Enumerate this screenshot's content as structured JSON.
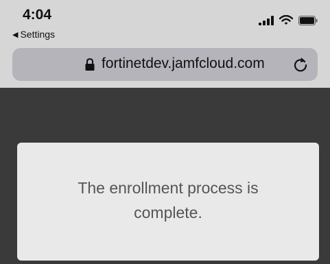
{
  "status_bar": {
    "time": "4:04",
    "back_label": "Settings",
    "icons": [
      "cellular-signal-icon",
      "wifi-icon",
      "battery-icon"
    ]
  },
  "browser": {
    "url": "fortinetdev.jamfcloud.com",
    "secure": true
  },
  "page": {
    "message": "The enrollment process is complete."
  },
  "colors": {
    "chrome_background": "#d6d6d6",
    "url_bar": "#b4b4ba",
    "page_background": "#3a3a3a",
    "card_background": "#e9e9e9",
    "message_text": "#555555"
  }
}
